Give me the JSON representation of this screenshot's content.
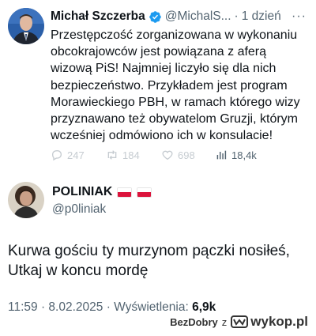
{
  "tweet": {
    "author_name": "Michał Szczerba",
    "handle": "@MichalS...",
    "separator": "·",
    "time": "1 dzień",
    "more_label": "···",
    "text_lines": [
      "Przestępczość zorganizowana w wykonaniu",
      "obcokrajowców jest powiązana z aferą",
      "wizową PiS! Najmniej liczyło się dla nich",
      "bezpieczeństwo. Przykładem jest program",
      "Morawieckiego PBH, w ramach którego wizy",
      "przyznawano też obywatelom Gruzji, którym",
      "wcześniej odmówiono ich w konsulacie!"
    ],
    "replies": "247",
    "retweets": "184",
    "likes": "698",
    "views": "18,4k"
  },
  "reply": {
    "author_name": "POLINIAK",
    "handle": "@p0liniak",
    "text_lines": [
      "Kurwa gościu ty murzynom pączki nosiłeś,",
      "Utkaj w koncu mordę"
    ],
    "time": "11:59",
    "date": "8.02.2025",
    "views_label": "Wyświetlenia:",
    "views": "6,9k"
  },
  "watermark": {
    "user": "BezDobry",
    "preposition": "z",
    "site": "wykop.pl"
  },
  "colors": {
    "verified": "#1d9bf0",
    "muted": "#536471",
    "flag_red": "#dc143c"
  }
}
